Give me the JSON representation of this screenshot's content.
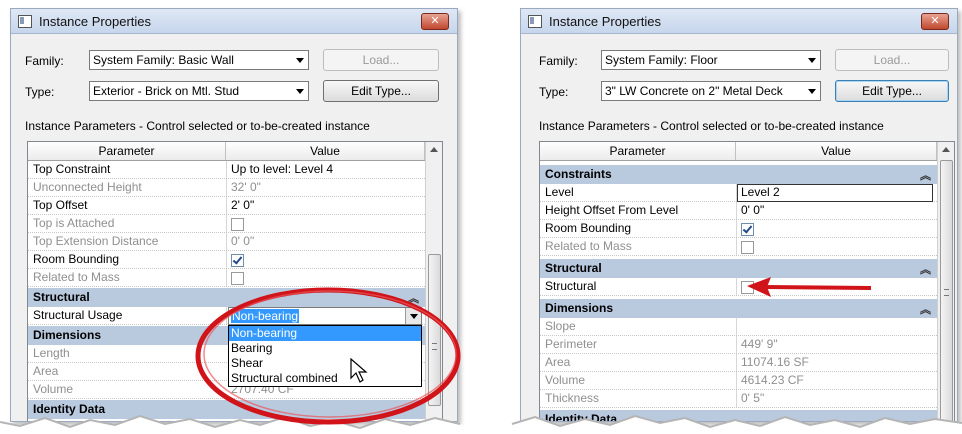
{
  "left_window": {
    "title": "Instance Properties",
    "family_label": "Family:",
    "family_value": "System Family: Basic Wall",
    "type_label": "Type:",
    "type_value": "Exterior - Brick on Mtl. Stud",
    "load_button": "Load...",
    "edit_type_button": "Edit Type...",
    "instance_params": "Instance Parameters - Control selected or to-be-created instance",
    "col_parameter": "Parameter",
    "col_value": "Value",
    "rows": {
      "top_constraint": {
        "name": "Top Constraint",
        "value": "Up to level: Level 4"
      },
      "unconnected_height": {
        "name": "Unconnected Height",
        "value": "32'  0\""
      },
      "top_offset": {
        "name": "Top Offset",
        "value": "2'  0\""
      },
      "top_is_attached": {
        "name": "Top is Attached"
      },
      "top_extension": {
        "name": "Top Extension Distance",
        "value": "0'  0\""
      },
      "room_bounding": {
        "name": "Room Bounding"
      },
      "related_to_mass": {
        "name": "Related to Mass"
      },
      "structural_usage": {
        "name": "Structural Usage",
        "value": "Non-bearing"
      },
      "length": {
        "name": "Length"
      },
      "area": {
        "name": "Area"
      },
      "volume": {
        "name": "Volume",
        "value": "2707.40 CF"
      }
    },
    "sections": {
      "structural": "Structural",
      "dimensions": "Dimensions",
      "identity": "Identity Data"
    },
    "dropdown_options": [
      "Non-bearing",
      "Bearing",
      "Shear",
      "Structural combined"
    ]
  },
  "right_window": {
    "title": "Instance Properties",
    "family_label": "Family:",
    "family_value": "System Family: Floor",
    "type_label": "Type:",
    "type_value": "3\" LW Concrete on 2\" Metal Deck",
    "load_button": "Load...",
    "edit_type_button": "Edit Type...",
    "instance_params": "Instance Parameters - Control selected or to-be-created instance",
    "col_parameter": "Parameter",
    "col_value": "Value",
    "sections": {
      "constraints": "Constraints",
      "structural": "Structural",
      "dimensions": "Dimensions",
      "identity": "Identity Data"
    },
    "rows": {
      "level": {
        "name": "Level",
        "value": "Level 2"
      },
      "height_offset": {
        "name": "Height Offset From Level",
        "value": "0'  0\""
      },
      "room_bounding": {
        "name": "Room Bounding"
      },
      "related_to_mass": {
        "name": "Related to Mass"
      },
      "structural": {
        "name": "Structural"
      },
      "slope": {
        "name": "Slope"
      },
      "perimeter": {
        "name": "Perimeter",
        "value": "449'  9\""
      },
      "area": {
        "name": "Area",
        "value": "11074.16 SF"
      },
      "volume": {
        "name": "Volume",
        "value": "4614.23 CF"
      },
      "thickness": {
        "name": "Thickness",
        "value": "0'  5\""
      }
    }
  },
  "colors": {
    "section_bg": "#b9c9de",
    "highlight": "#3399ff",
    "annotation_red": "#d0141a"
  }
}
